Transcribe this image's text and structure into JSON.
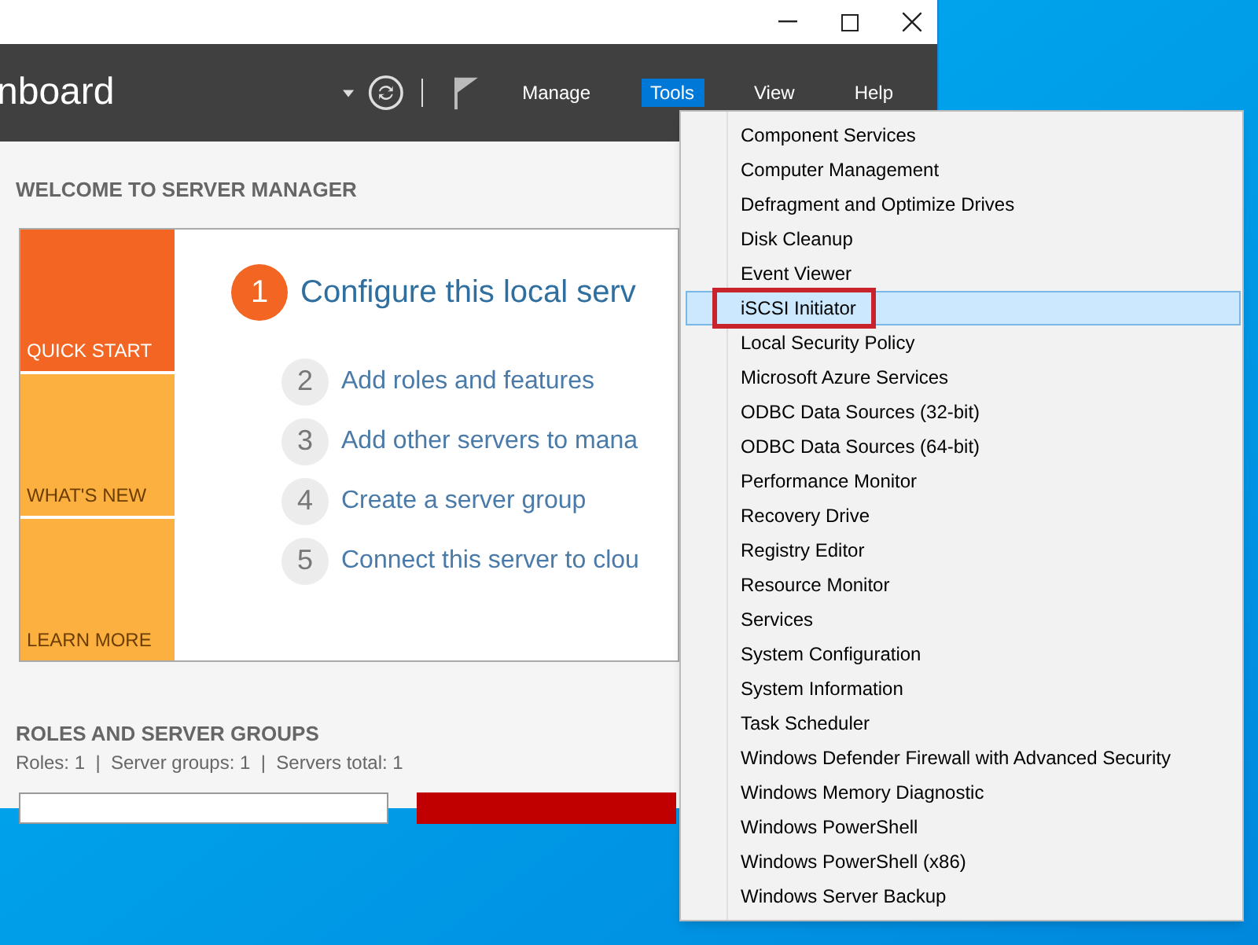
{
  "window": {
    "title_partial": "nboard"
  },
  "menu_bar": [
    {
      "label": "Manage",
      "selected": false
    },
    {
      "label": "Tools",
      "selected": true
    },
    {
      "label": "View",
      "selected": false
    },
    {
      "label": "Help",
      "selected": false
    }
  ],
  "welcome": {
    "heading": "WELCOME TO SERVER MANAGER",
    "tiles": [
      {
        "label": "QUICK START",
        "selected": true
      },
      {
        "label": "WHAT'S NEW",
        "selected": false
      },
      {
        "label": "LEARN MORE",
        "selected": false
      }
    ],
    "steps": [
      {
        "number": "1",
        "text": "Configure this local serv",
        "kind": "primary"
      },
      {
        "number": "2",
        "text": "Add roles and features",
        "kind": "secondary"
      },
      {
        "number": "3",
        "text": "Add other servers to mana",
        "kind": "secondary"
      },
      {
        "number": "4",
        "text": "Create a server group",
        "kind": "secondary"
      },
      {
        "number": "5",
        "text": "Connect this server to clou",
        "kind": "secondary"
      }
    ]
  },
  "roles": {
    "heading": "ROLES AND SERVER GROUPS",
    "summary": "Roles: 1  |  Server groups: 1  |  Servers total: 1"
  },
  "tools_menu": [
    {
      "label": "Component Services",
      "selected": false,
      "annotated": false
    },
    {
      "label": "Computer Management",
      "selected": false,
      "annotated": false
    },
    {
      "label": "Defragment and Optimize Drives",
      "selected": false,
      "annotated": false
    },
    {
      "label": "Disk Cleanup",
      "selected": false,
      "annotated": false
    },
    {
      "label": "Event Viewer",
      "selected": false,
      "annotated": false
    },
    {
      "label": "iSCSI Initiator",
      "selected": true,
      "annotated": true
    },
    {
      "label": "Local Security Policy",
      "selected": false,
      "annotated": false
    },
    {
      "label": "Microsoft Azure Services",
      "selected": false,
      "annotated": false
    },
    {
      "label": "ODBC Data Sources (32-bit)",
      "selected": false,
      "annotated": false
    },
    {
      "label": "ODBC Data Sources (64-bit)",
      "selected": false,
      "annotated": false
    },
    {
      "label": "Performance Monitor",
      "selected": false,
      "annotated": false
    },
    {
      "label": "Recovery Drive",
      "selected": false,
      "annotated": false
    },
    {
      "label": "Registry Editor",
      "selected": false,
      "annotated": false
    },
    {
      "label": "Resource Monitor",
      "selected": false,
      "annotated": false
    },
    {
      "label": "Services",
      "selected": false,
      "annotated": false
    },
    {
      "label": "System Configuration",
      "selected": false,
      "annotated": false
    },
    {
      "label": "System Information",
      "selected": false,
      "annotated": false
    },
    {
      "label": "Task Scheduler",
      "selected": false,
      "annotated": false
    },
    {
      "label": "Windows Defender Firewall with Advanced Security",
      "selected": false,
      "annotated": false
    },
    {
      "label": "Windows Memory Diagnostic",
      "selected": false,
      "annotated": false
    },
    {
      "label": "Windows PowerShell",
      "selected": false,
      "annotated": false
    },
    {
      "label": "Windows PowerShell (x86)",
      "selected": false,
      "annotated": false
    },
    {
      "label": "Windows Server Backup",
      "selected": false,
      "annotated": false
    }
  ]
}
